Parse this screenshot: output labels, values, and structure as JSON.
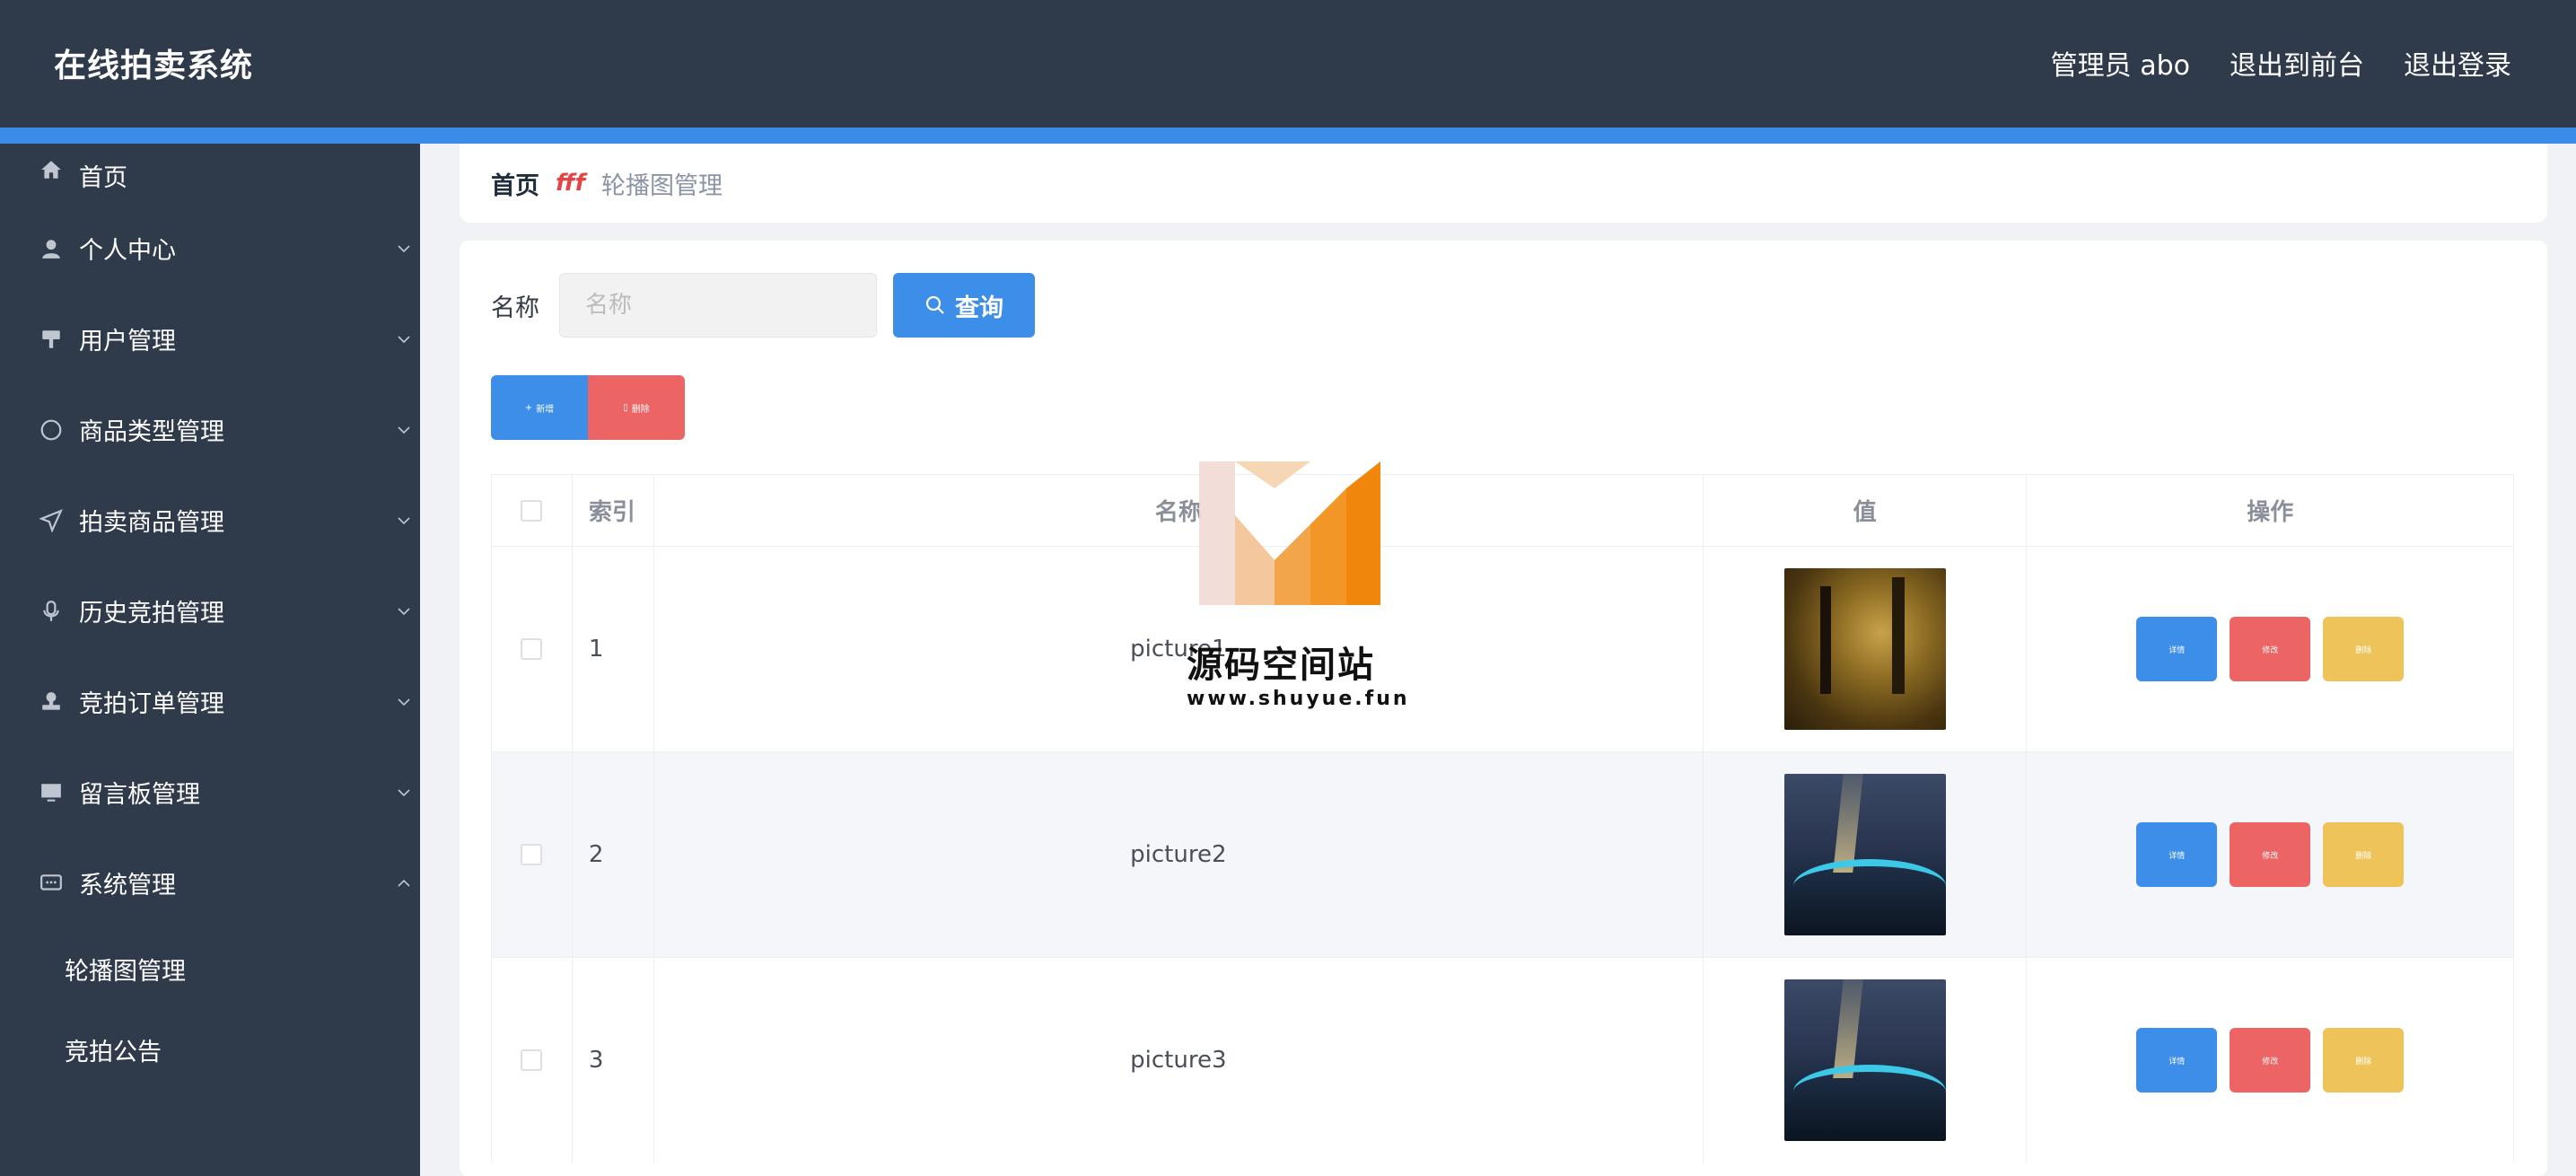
{
  "header": {
    "title": "在线拍卖系统",
    "user": "管理员 abo",
    "to_front": "退出到前台",
    "logout": "退出登录"
  },
  "sidebar": {
    "items": [
      {
        "label": "首页",
        "icon": "home-icon",
        "expandable": false
      },
      {
        "label": "个人中心",
        "icon": "user-icon",
        "expandable": true
      },
      {
        "label": "用户管理",
        "icon": "brush-icon",
        "expandable": true
      },
      {
        "label": "商品类型管理",
        "icon": "compass-icon",
        "expandable": true
      },
      {
        "label": "拍卖商品管理",
        "icon": "send-icon",
        "expandable": true
      },
      {
        "label": "历史竞拍管理",
        "icon": "microphone-icon",
        "expandable": true
      },
      {
        "label": "竞拍订单管理",
        "icon": "stamp-icon",
        "expandable": true
      },
      {
        "label": "留言板管理",
        "icon": "monitor-icon",
        "expandable": true
      },
      {
        "label": "系统管理",
        "icon": "chat-icon",
        "expandable": true,
        "expanded": true
      }
    ],
    "subitems": [
      {
        "label": "轮播图管理"
      },
      {
        "label": "竞拍公告"
      }
    ]
  },
  "breadcrumb": {
    "home": "首页",
    "separator": "fff",
    "current": "轮播图管理"
  },
  "search": {
    "label": "名称",
    "placeholder": "名称",
    "value": "",
    "button": "查询"
  },
  "actions": {
    "add": "新增",
    "delete": "删除"
  },
  "table": {
    "columns": [
      "索引",
      "名称",
      "值",
      "操作"
    ],
    "rows": [
      {
        "index": "1",
        "name": "picture1",
        "image": "thumbnail-1"
      },
      {
        "index": "2",
        "name": "picture2",
        "image": "thumbnail-2"
      },
      {
        "index": "3",
        "name": "picture3",
        "image": "thumbnail-2"
      }
    ],
    "row_actions": {
      "detail": "详情",
      "edit": "修改",
      "delete": "删除"
    }
  },
  "watermark": {
    "text": "源码空间站",
    "url": "www.shuyue.fun"
  },
  "colors": {
    "header_bg": "#2f3a4b",
    "accent": "#3b8ce8",
    "primary_button": "#3d8ee8",
    "danger_button": "#ec6463",
    "warning_button": "#eec45a"
  }
}
